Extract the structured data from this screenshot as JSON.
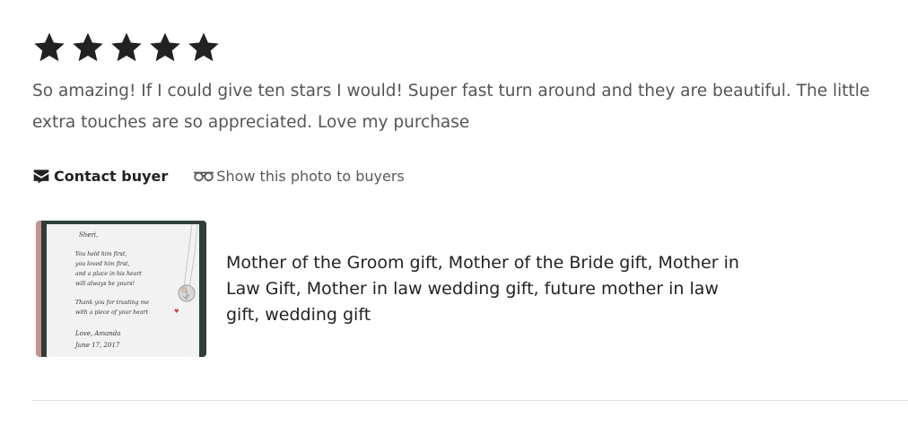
{
  "review": {
    "rating": 5,
    "max_rating": 5,
    "text": "So amazing! If I could give ten stars I would! Super fast turn around and they are beautiful. The little extra touches are so appreciated. Love my purchase"
  },
  "actions": {
    "contact_label": "Contact buyer",
    "contact_icon": "envelope-icon",
    "show_photo_label": "Show this photo to buyers",
    "show_photo_icon": "glasses-icon"
  },
  "listing": {
    "title": "Mother of the Groom gift, Mother of the Bride gift, Mother in Law Gift, Mother in law wedding gift, future mother in law gift, wedding gift",
    "card": {
      "salutation": "Sheri,",
      "line1": "You held him first,",
      "line2": "you loved him first,",
      "line3": "and a place in his heart",
      "line4": "will always be yours!",
      "line5": "Thank you for trusting me",
      "line6": "with a piece of your heart",
      "signoff": "Love, Amanda",
      "date": "June 17, 2017"
    }
  },
  "colors": {
    "star": "#222222",
    "text_muted": "#555555",
    "divider": "#e1e1e1"
  }
}
